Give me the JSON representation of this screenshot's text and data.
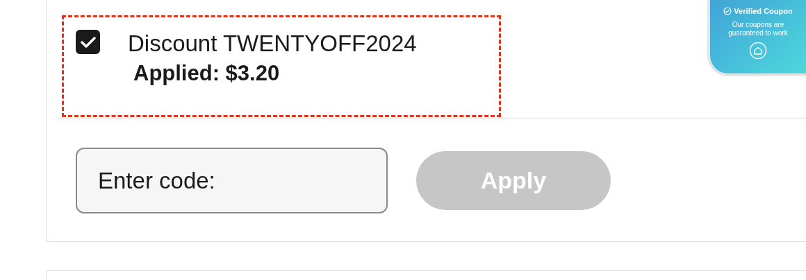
{
  "badge": {
    "title": "Verified Coupon",
    "text": "Our coupons are guaranteed to work"
  },
  "discount": {
    "checked": true,
    "label": "Discount TWENTYOFF2024",
    "applied": "Applied: $3.20"
  },
  "code_field": {
    "placeholder": "Enter code:"
  },
  "apply_button": {
    "label": "Apply",
    "disabled": true
  }
}
